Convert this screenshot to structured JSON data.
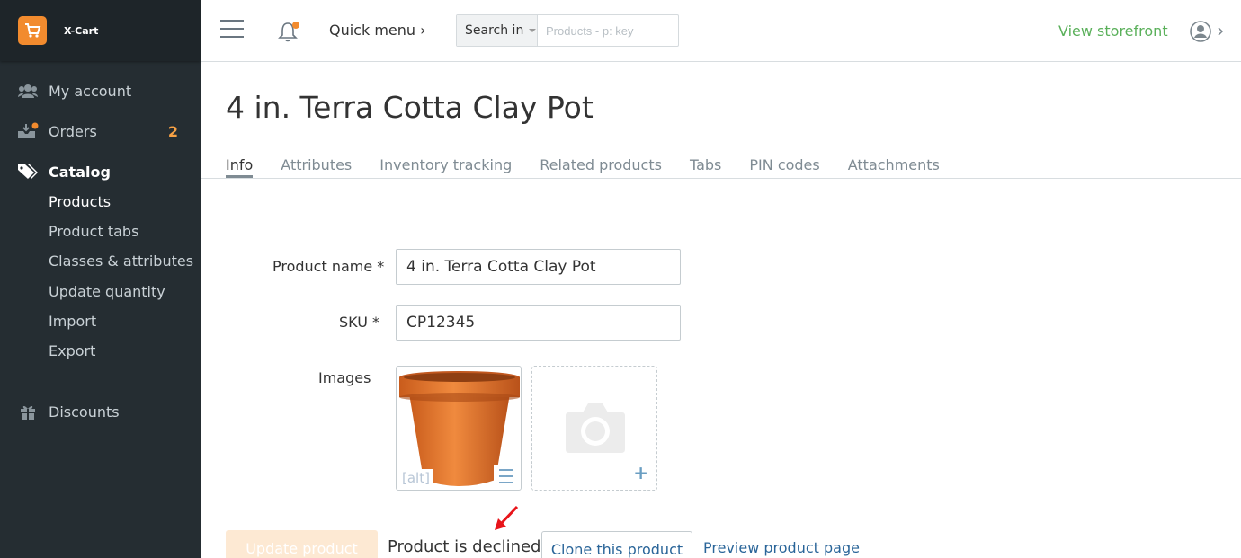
{
  "app": {
    "brand": "X-Cart"
  },
  "sidebar": {
    "items": [
      {
        "label": "My account"
      },
      {
        "label": "Orders",
        "badge": "2"
      },
      {
        "label": "Catalog"
      },
      {
        "label": "Discounts"
      }
    ],
    "catalog_sub": [
      "Products",
      "Product tabs",
      "Classes & attributes",
      "Update quantity",
      "Import",
      "Export"
    ]
  },
  "header": {
    "quick_menu": "Quick menu ›",
    "search_in": "Search in",
    "search_placeholder": "Products - p: key",
    "storefront": "View storefront"
  },
  "page": {
    "title": "4 in. Terra Cotta Clay Pot",
    "tabs": [
      "Info",
      "Attributes",
      "Inventory tracking",
      "Related products",
      "Tabs",
      "PIN codes",
      "Attachments"
    ]
  },
  "form": {
    "product_name_label": "Product name *",
    "product_name_value": "4 in. Terra Cotta Clay Pot",
    "sku_label": "SKU *",
    "sku_value": "CP12345",
    "images_label": "Images",
    "alt_label": "[alt]"
  },
  "footer": {
    "update_button": "Update product",
    "status_text": "Product is declined",
    "clone_button": "Clone this product",
    "preview_link": "Preview product page"
  },
  "colors": {
    "accent": "#f28b2e",
    "sidebar_bg": "#252d32",
    "link": "#2a6599",
    "storefront": "#5ab05a"
  },
  "icons": [
    "cart-logo-icon",
    "users-icon",
    "orders-icon",
    "tags-icon",
    "gift-icon",
    "hamburger-icon",
    "bell-icon",
    "user-icon",
    "camera-icon",
    "plus-icon",
    "arrow-annotation-icon"
  ]
}
